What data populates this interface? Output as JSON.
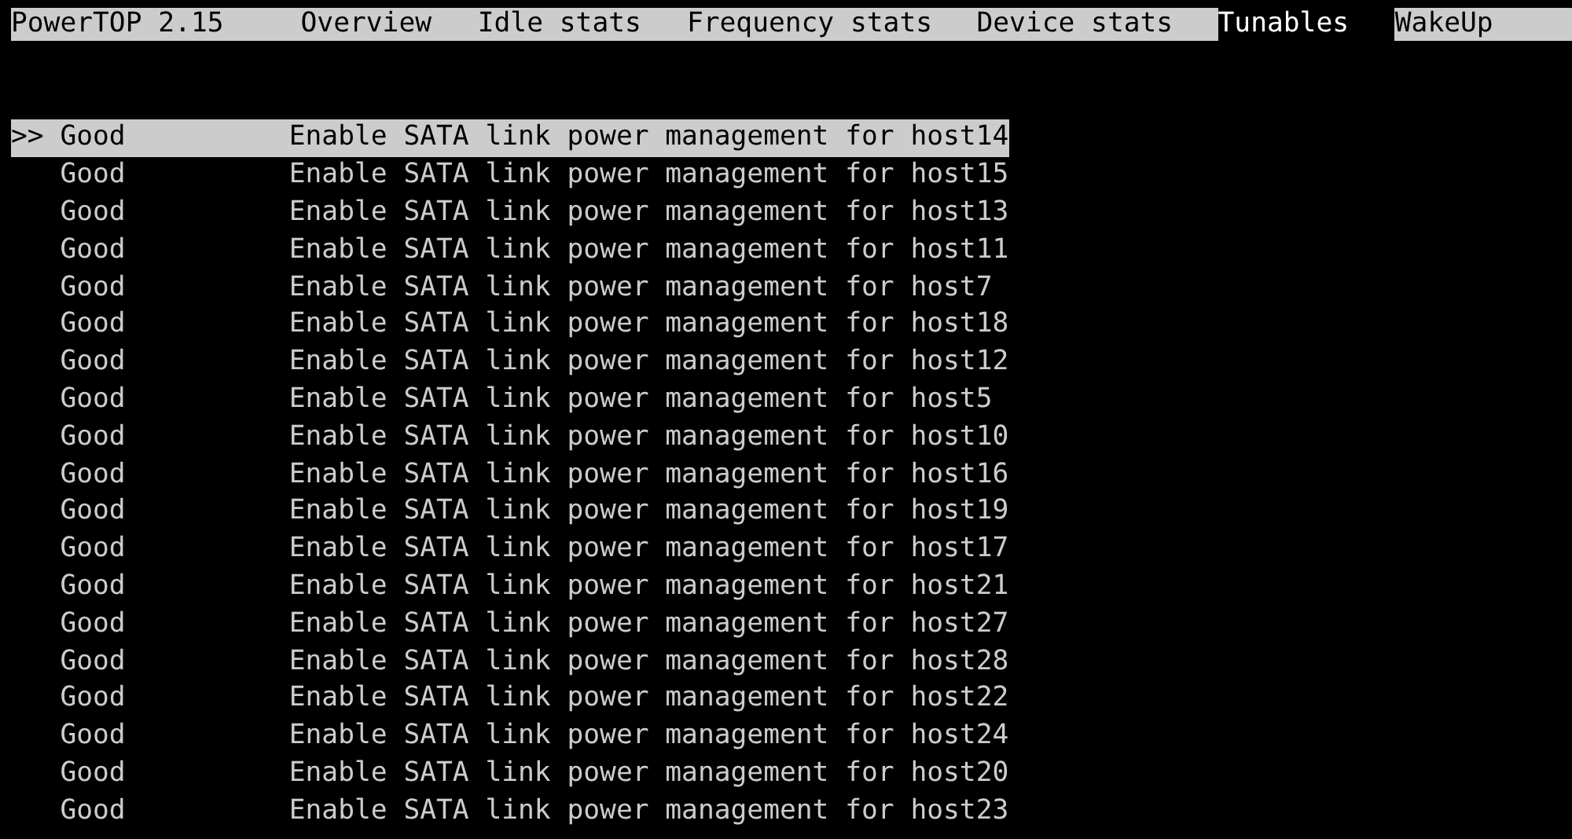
{
  "header": {
    "title": "PowerTOP 2.15",
    "tabs": [
      {
        "label": "Overview",
        "selected": false
      },
      {
        "label": "Idle stats",
        "selected": false
      },
      {
        "label": "Frequency stats",
        "selected": false
      },
      {
        "label": "Device stats",
        "selected": false
      },
      {
        "label": "Tunables",
        "selected": true
      },
      {
        "label": "WakeUp",
        "selected": false
      }
    ]
  },
  "tunables": [
    {
      "marker": ">>",
      "status": "Good",
      "description": "Enable SATA link power management for host14",
      "selected": true
    },
    {
      "status": "Good",
      "description": "Enable SATA link power management for host15",
      "selected": false
    },
    {
      "status": "Good",
      "description": "Enable SATA link power management for host13",
      "selected": false
    },
    {
      "status": "Good",
      "description": "Enable SATA link power management for host11",
      "selected": false
    },
    {
      "status": "Good",
      "description": "Enable SATA link power management for host7",
      "selected": false
    },
    {
      "status": "Good",
      "description": "Enable SATA link power management for host18",
      "selected": false
    },
    {
      "status": "Good",
      "description": "Enable SATA link power management for host12",
      "selected": false
    },
    {
      "status": "Good",
      "description": "Enable SATA link power management for host5",
      "selected": false
    },
    {
      "status": "Good",
      "description": "Enable SATA link power management for host10",
      "selected": false
    },
    {
      "status": "Good",
      "description": "Enable SATA link power management for host16",
      "selected": false
    },
    {
      "status": "Good",
      "description": "Enable SATA link power management for host19",
      "selected": false
    },
    {
      "status": "Good",
      "description": "Enable SATA link power management for host17",
      "selected": false
    },
    {
      "status": "Good",
      "description": "Enable SATA link power management for host21",
      "selected": false
    },
    {
      "status": "Good",
      "description": "Enable SATA link power management for host27",
      "selected": false
    },
    {
      "status": "Good",
      "description": "Enable SATA link power management for host28",
      "selected": false
    },
    {
      "status": "Good",
      "description": "Enable SATA link power management for host22",
      "selected": false
    },
    {
      "status": "Good",
      "description": "Enable SATA link power management for host24",
      "selected": false
    },
    {
      "status": "Good",
      "description": "Enable SATA link power management for host20",
      "selected": false
    },
    {
      "status": "Good",
      "description": "Enable SATA link power management for host23",
      "selected": false
    }
  ]
}
